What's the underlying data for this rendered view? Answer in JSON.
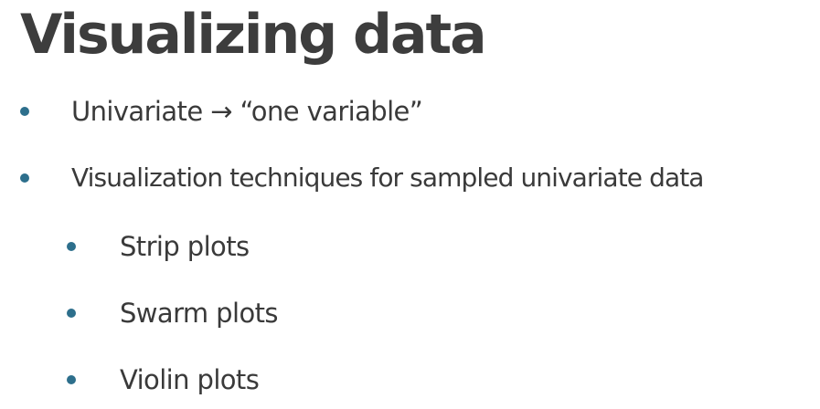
{
  "slide": {
    "title": "Visualizing data",
    "bullets": [
      {
        "text": "Univariate → “one variable”"
      },
      {
        "text": "Visualization techniques for sampled univariate data"
      }
    ],
    "sub_bullets": [
      {
        "text": "Strip plots"
      },
      {
        "text": "Swarm plots"
      },
      {
        "text": "Violin plots"
      }
    ]
  },
  "colors": {
    "bullet": "#2d6f8c",
    "title": "#3d3d3d",
    "text": "#3a3a3a",
    "background": "#ffffff"
  }
}
